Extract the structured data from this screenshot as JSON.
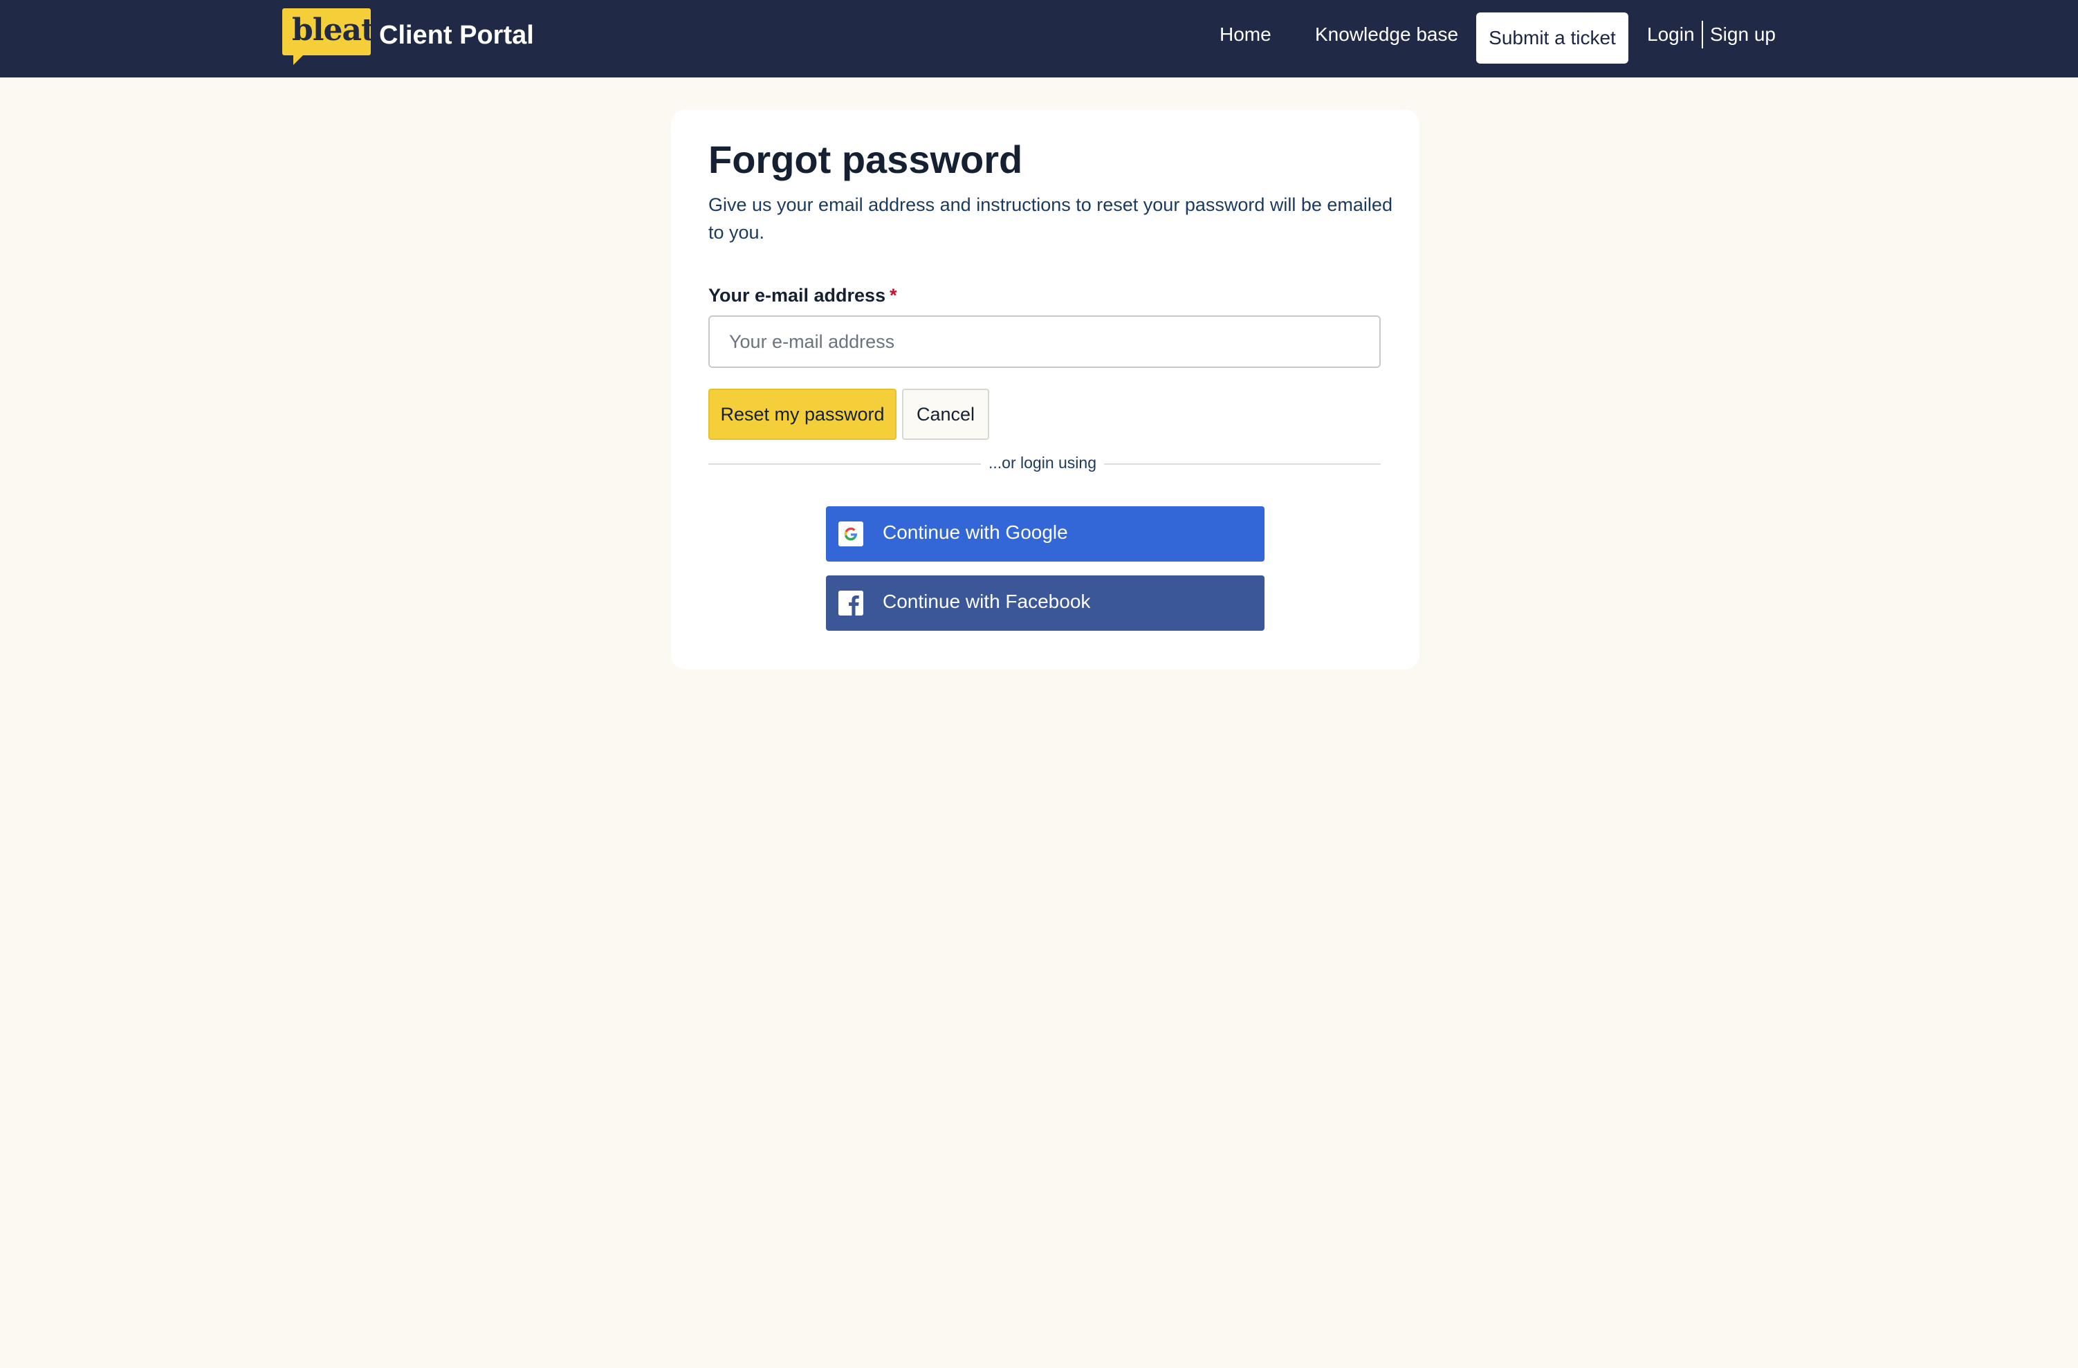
{
  "header": {
    "logo_text": "bleat",
    "title": "Client Portal",
    "nav": {
      "home": "Home",
      "knowledge_base": "Knowledge base",
      "submit_ticket": "Submit a ticket",
      "login": "Login",
      "signup": "Sign up"
    }
  },
  "form": {
    "title": "Forgot password",
    "description": "Give us your email address and instructions to reset your password will be emailed to you.",
    "email_label": "Your e-mail address",
    "required_marker": "*",
    "email_placeholder": "Your e-mail address",
    "email_value": "",
    "reset_button": "Reset my password",
    "cancel_button": "Cancel",
    "divider_text": "...or login using",
    "google_button": "Continue with Google",
    "facebook_button": "Continue with Facebook"
  },
  "icons": {
    "google": "google-icon",
    "facebook": "facebook-icon"
  },
  "colors": {
    "header_bg": "#202946",
    "page_bg": "#fcf9f2",
    "accent_yellow": "#f5cf3a",
    "google_blue": "#3366d6",
    "facebook_blue": "#3b5797",
    "required_red": "#c8102e"
  }
}
